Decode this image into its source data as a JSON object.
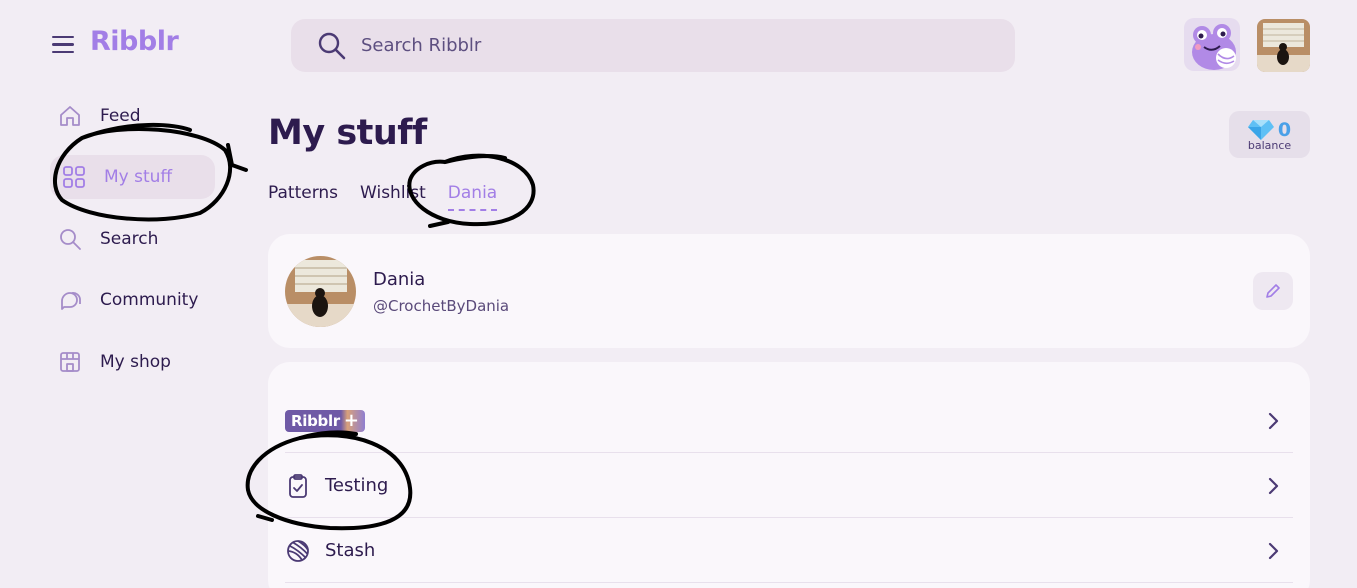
{
  "app": {
    "logo": "Ribblr"
  },
  "search": {
    "placeholder": "Search Ribblr"
  },
  "sidebar": {
    "items": [
      {
        "label": "Feed",
        "icon": "home-icon"
      },
      {
        "label": "My stuff",
        "icon": "grid-icon",
        "active": true
      },
      {
        "label": "Search",
        "icon": "search-icon"
      },
      {
        "label": "Community",
        "icon": "chat-bubbles-icon"
      },
      {
        "label": "My shop",
        "icon": "storefront-icon"
      }
    ]
  },
  "page": {
    "title": "My stuff"
  },
  "balance": {
    "value": "0",
    "caption": "balance",
    "icon": "diamond-icon"
  },
  "tabs": [
    {
      "label": "Patterns"
    },
    {
      "label": "Wishlist"
    },
    {
      "label": "Dania",
      "active": true
    }
  ],
  "profile": {
    "name": "Dania",
    "handle": "@CrochetByDania"
  },
  "list": {
    "plus_logo_text": "Ribblr",
    "plus_logo_symbol": "+",
    "testing_label": "Testing",
    "stash_label": "Stash"
  },
  "colors": {
    "accent": "#a27ee6",
    "text": "#2d1b4e",
    "background": "#f2edf4",
    "card": "#faf7fb"
  }
}
